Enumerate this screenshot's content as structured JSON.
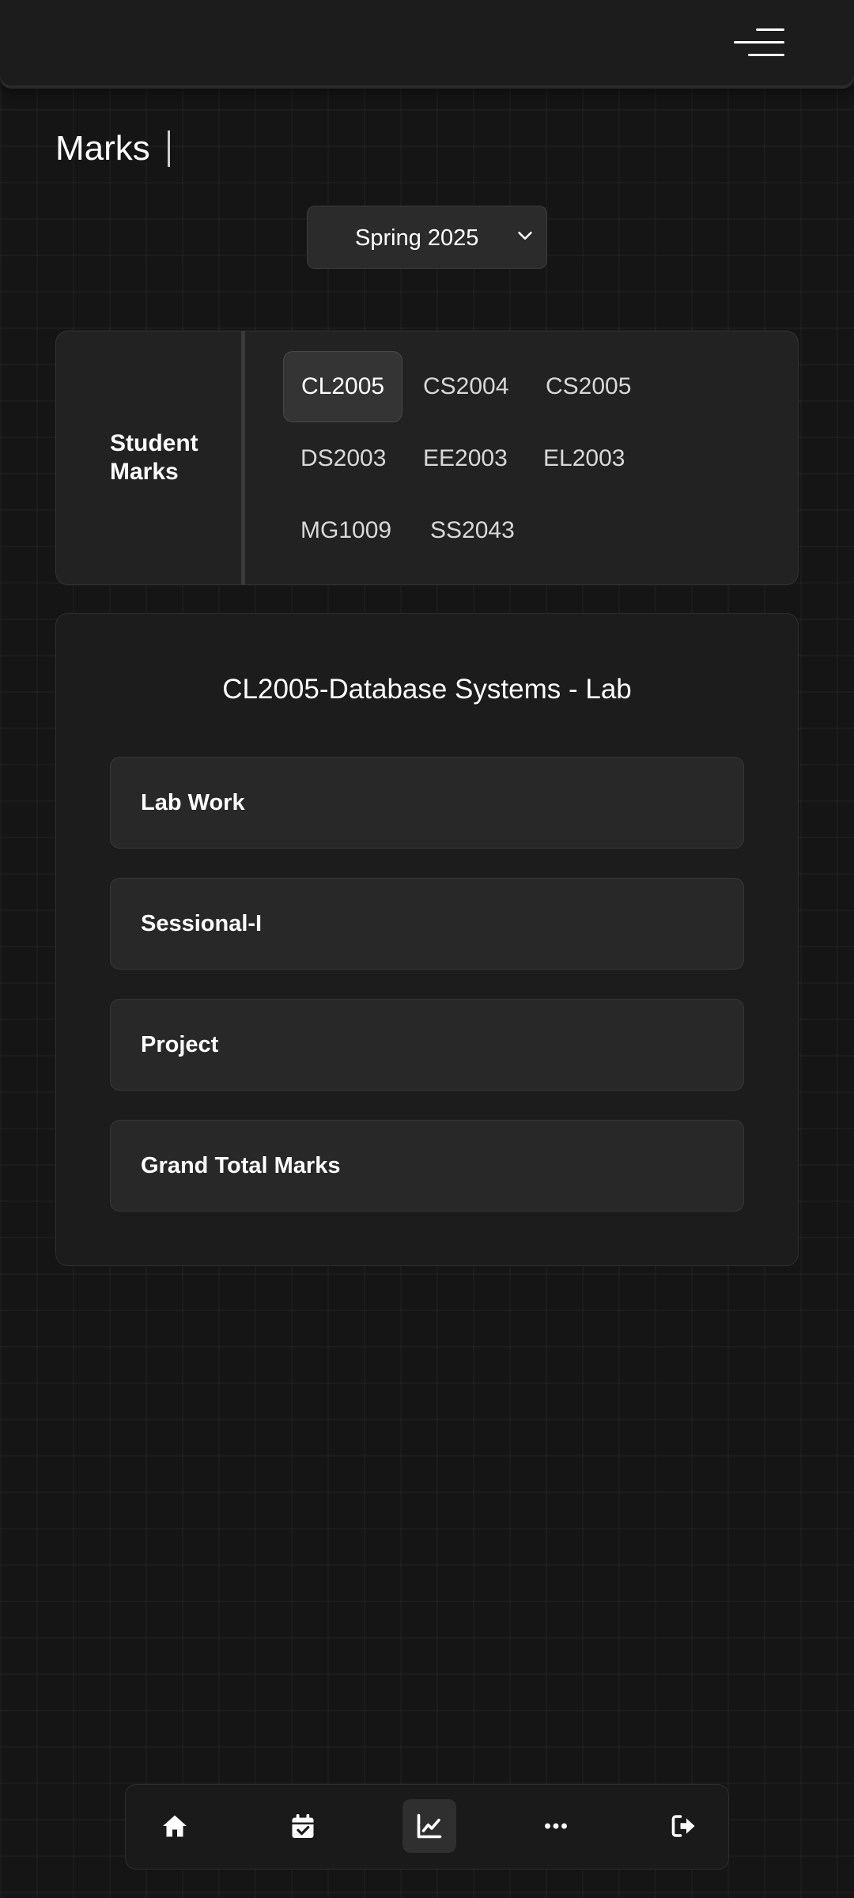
{
  "header": {
    "menu_icon": "hamburger-menu-icon"
  },
  "page": {
    "title": "Marks"
  },
  "semester_select": {
    "value": "Spring 2025",
    "icon": "chevron-down-icon"
  },
  "course_panel": {
    "label": "Student Marks",
    "courses": [
      "CL2005",
      "CS2004",
      "CS2005",
      "DS2003",
      "EE2003",
      "EL2003",
      "MG1009",
      "SS2043"
    ],
    "selected": "CL2005"
  },
  "details": {
    "title": "CL2005-Database Systems - Lab",
    "sections": [
      "Lab Work",
      "Sessional-I",
      "Project",
      "Grand Total Marks"
    ]
  },
  "bottom_nav": {
    "items": [
      "home-icon",
      "calendar-check-icon",
      "chart-line-icon",
      "more-dots-icon",
      "logout-icon"
    ],
    "active": "chart-line-icon"
  },
  "colors": {
    "background": "#151515",
    "surface": "#222222",
    "row": "#282828",
    "text": "#ffffff",
    "muted_text": "#d8d8d8"
  }
}
